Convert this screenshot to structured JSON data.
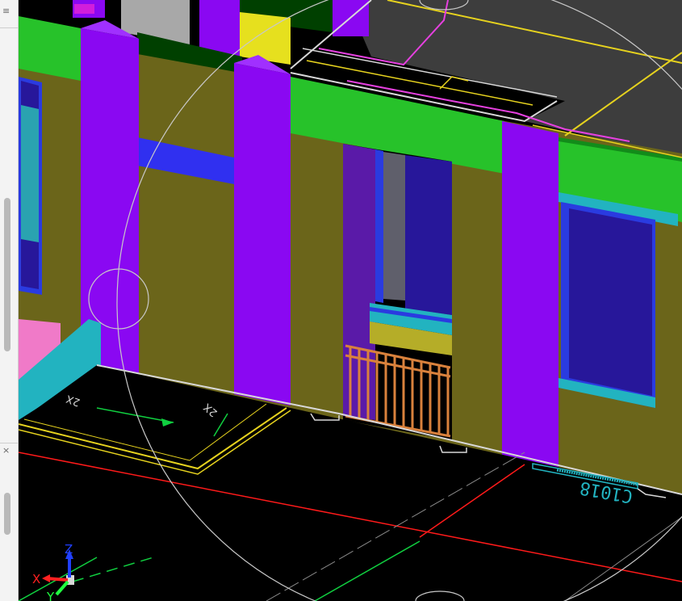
{
  "window": {
    "side_panel_glyph_top": "≡",
    "side_panel_close": "×"
  },
  "viewport": {
    "mode": "3D shaded",
    "room_tag": "C1018",
    "dim_label_left": "2X",
    "dim_label_right": "2X"
  },
  "ucs_icon": {
    "x_label": "X",
    "y_label": "Y",
    "z_label": "Z",
    "x_color": "#ff2020",
    "y_color": "#20ff40",
    "z_color": "#2040ff"
  },
  "colors": {
    "wall": "#6b651a",
    "column": "#8a08f2",
    "slab_edge": "#27c22a",
    "glass": "#27179a",
    "frame": "#2a3be0",
    "sill": "#22b3c0",
    "railing": "#d9813c",
    "floor_plan": "#000000"
  }
}
